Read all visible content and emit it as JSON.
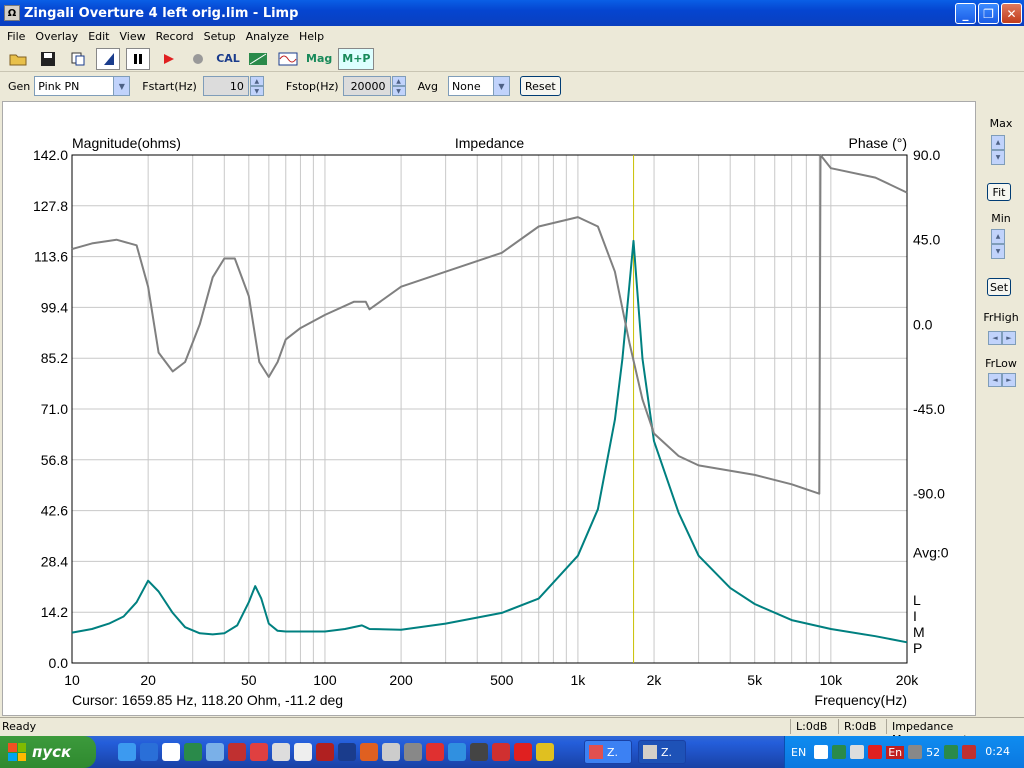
{
  "window": {
    "title": "Zingali Overture 4 left orig.lim - Limp"
  },
  "menu": [
    "File",
    "Overlay",
    "Edit",
    "View",
    "Record",
    "Setup",
    "Analyze",
    "Help"
  ],
  "toolbar": {
    "cal_label": "CAL",
    "mag_label": "Mag",
    "mp_label": "M+P"
  },
  "gen": {
    "gen_label": "Gen",
    "gen_value": "Pink PN",
    "fstart_label": "Fstart(Hz)",
    "fstart_value": "10",
    "fstop_label": "Fstop(Hz)",
    "fstop_value": "20000",
    "avg_label": "Avg",
    "avg_value": "None",
    "reset_label": "Reset"
  },
  "side": {
    "max_label": "Max",
    "fit_label": "Fit",
    "min_label": "Min",
    "set_label": "Set",
    "frhigh_label": "FrHigh",
    "frlow_label": "FrLow"
  },
  "status": {
    "ready": "Ready",
    "l_level": "L:0dB",
    "r_level": "R:0dB",
    "mode": "Impedance Measurement"
  },
  "taskbar": {
    "start_label": "пуск",
    "task1": "Z.",
    "task2": "Z.",
    "lang": "EN",
    "lang2": "En",
    "num": "52",
    "clock": "0:24"
  },
  "chart_data": {
    "type": "line",
    "title": "Impedance",
    "left_axis_label": "Magnitude(ohms)",
    "right_axis_label": "Phase (°)",
    "xlabel": "Frequency(Hz)",
    "x_scale": "log",
    "xlim": [
      10,
      20000
    ],
    "ylim": [
      0,
      142
    ],
    "y2lim": [
      -180,
      90
    ],
    "x_ticks": [
      10,
      20,
      50,
      100,
      200,
      500,
      1000,
      2000,
      5000,
      10000,
      20000
    ],
    "x_tick_labels": [
      "10",
      "20",
      "50",
      "100",
      "200",
      "500",
      "1k",
      "2k",
      "5k",
      "10k",
      "20k"
    ],
    "y_ticks": [
      0,
      14.2,
      28.4,
      42.6,
      56.8,
      71.0,
      85.2,
      99.4,
      113.6,
      127.8,
      142.0
    ],
    "y_tick_labels": [
      "0.0",
      "14.2",
      "28.4",
      "42.6",
      "56.8",
      "71.0",
      "85.2",
      "99.4",
      "113.6",
      "127.8",
      "142.0"
    ],
    "y2_ticks": [
      90,
      45,
      0,
      -45,
      -90
    ],
    "y2_tick_labels": [
      "90.0",
      "45.0",
      "0.0",
      "-45.0",
      "-90.0"
    ],
    "avg_text": "Avg:0",
    "side_text": [
      "L",
      "I",
      "M",
      "P"
    ],
    "cursor_text": "Cursor: 1659.85 Hz, 118.20 Ohm, -11.2 deg",
    "cursor_freq": 1659.85,
    "grid": true,
    "colors": {
      "magnitude": "#008080",
      "phase": "#808080",
      "cursor": "#c8c000"
    },
    "series": [
      {
        "name": "Magnitude",
        "axis": "left",
        "x": [
          10,
          12,
          14,
          16,
          18,
          20,
          22,
          25,
          28,
          32,
          36,
          40,
          45,
          50,
          53,
          56,
          60,
          65,
          70,
          80,
          100,
          120,
          140,
          145,
          150,
          200,
          300,
          500,
          700,
          1000,
          1200,
          1400,
          1500,
          1600,
          1659,
          1700,
          1800,
          2000,
          2500,
          3000,
          4000,
          5000,
          7000,
          10000,
          15000,
          20000
        ],
        "y": [
          8.5,
          9.5,
          11,
          13,
          17,
          23,
          20,
          14,
          10,
          8.3,
          8,
          8.3,
          10.5,
          17,
          21.5,
          18,
          11,
          9,
          8.8,
          8.8,
          8.8,
          9.5,
          10.5,
          10,
          9.5,
          9.3,
          11,
          14,
          18,
          30,
          43,
          68,
          85,
          106,
          118,
          108,
          85,
          62,
          42,
          30,
          21,
          16.5,
          12,
          9.5,
          7.5,
          5.8
        ]
      },
      {
        "name": "Phase",
        "axis": "right",
        "x": [
          10,
          12,
          15,
          18,
          20,
          22,
          25,
          28,
          32,
          36,
          40,
          44,
          50,
          55,
          60,
          65,
          70,
          80,
          100,
          130,
          145,
          150,
          200,
          300,
          500,
          700,
          1000,
          1200,
          1400,
          1600,
          1800,
          2000,
          2500,
          3000,
          5000,
          7000,
          9000,
          9100,
          10000,
          15000,
          20000
        ],
        "y": [
          40,
          43,
          45,
          42,
          20,
          -15,
          -25,
          -20,
          0,
          25,
          35,
          35,
          15,
          -20,
          -28,
          -20,
          -8,
          -2,
          5,
          12,
          12,
          8,
          20,
          28,
          38,
          52,
          57,
          52,
          28,
          -10,
          -40,
          -58,
          -70,
          -75,
          -80,
          -85,
          -90,
          90,
          83,
          78,
          70
        ]
      }
    ]
  }
}
